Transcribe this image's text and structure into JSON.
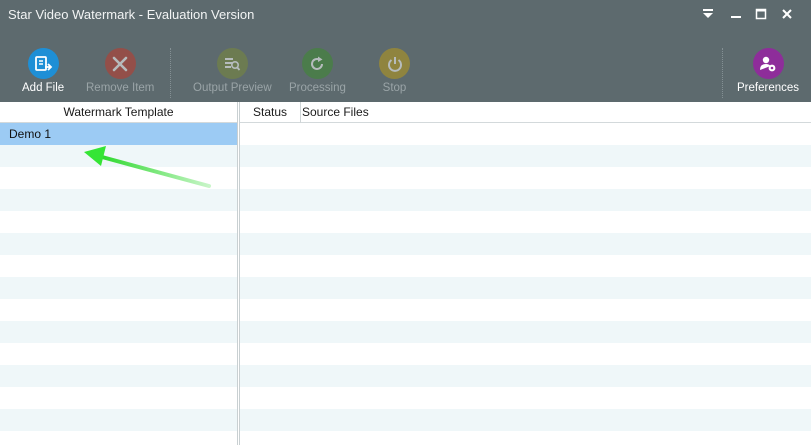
{
  "window": {
    "title": "Star Video Watermark - Evaluation Version"
  },
  "toolbar": {
    "add_file": {
      "label": "Add File",
      "icon": "add-file-icon",
      "color": "#1e8fd6",
      "enabled": true
    },
    "remove_item": {
      "label": "Remove Item",
      "icon": "remove-icon",
      "color": "#c0392b",
      "enabled": false
    },
    "output_preview": {
      "label": "Output Preview",
      "icon": "preview-icon",
      "color": "#7a8a3a",
      "enabled": false
    },
    "processing": {
      "label": "Processing",
      "icon": "refresh-icon",
      "color": "#3d8b2f",
      "enabled": false
    },
    "stop": {
      "label": "Stop",
      "icon": "power-icon",
      "color": "#b99a1a",
      "enabled": false
    },
    "preferences": {
      "label": "Preferences",
      "icon": "user-settings-icon",
      "color": "#8e2d9a",
      "enabled": true
    }
  },
  "left_panel": {
    "header": "Watermark Template",
    "items": [
      {
        "name": "Demo 1",
        "selected": true
      }
    ]
  },
  "right_panel": {
    "columns": [
      "Status",
      "Source Files"
    ]
  },
  "colors": {
    "chrome": "#5d6a6e",
    "selected_row": "#9ccbf4",
    "stripe": "#eff7f9",
    "annotation_arrow": "#35e535"
  }
}
